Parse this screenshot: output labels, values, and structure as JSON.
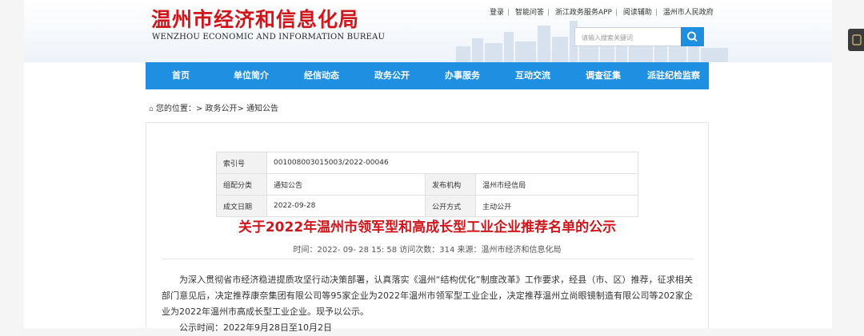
{
  "header": {
    "title_cn": "温州市经济和信息化局",
    "title_en": "WENZHOU ECONOMIC AND INFORMATION BUREAU",
    "top_links": [
      "登录",
      "智能问答",
      "浙江政务服务APP",
      "阅读辅助",
      "温州市人民政府"
    ],
    "search_placeholder": "请输入搜索关键词"
  },
  "nav": [
    "首页",
    "单位简介",
    "经信动态",
    "政务公开",
    "办事服务",
    "互动交流",
    "调查征集",
    "派驻纪检监察"
  ],
  "breadcrumb": "您的位置：> 政务公开> 通知公告",
  "info": {
    "index_label": "索引号",
    "index_value": "001008003015003/2022-00046",
    "category_label": "组配分类",
    "category_value": "通知公告",
    "publisher_label": "发布机构",
    "publisher_value": "温州市经信局",
    "date_label": "成文日期",
    "date_value": "2022-09-28",
    "mode_label": "公开方式",
    "mode_value": "主动公开"
  },
  "article": {
    "title": "关于2022年温州市领军型和高成长型工业企业推荐名单的公示",
    "meta": "时间：2022- 09- 28 15: 58 访问次数：314 来源：温州市经济和信息化局",
    "para1": "为深入贯彻省市经济稳进提质攻坚行动决策部署，认真落实《温州“结构优化”制度改革》工作要求，经县（市、区）推荐，征求相关部门意见后，决定推荐康奈集团有限公司等95家企业为2022年温州市领军型工业企业，决定推荐温州立尚眼镜制造有限公司等202家企业为2022年温州市高成长型工业企业。现予以公示。",
    "para2": "公示时间：2022年9月28日至10月2日"
  },
  "colors": {
    "brand_red": "#d0161b",
    "nav_blue": "#1e8fe1"
  }
}
